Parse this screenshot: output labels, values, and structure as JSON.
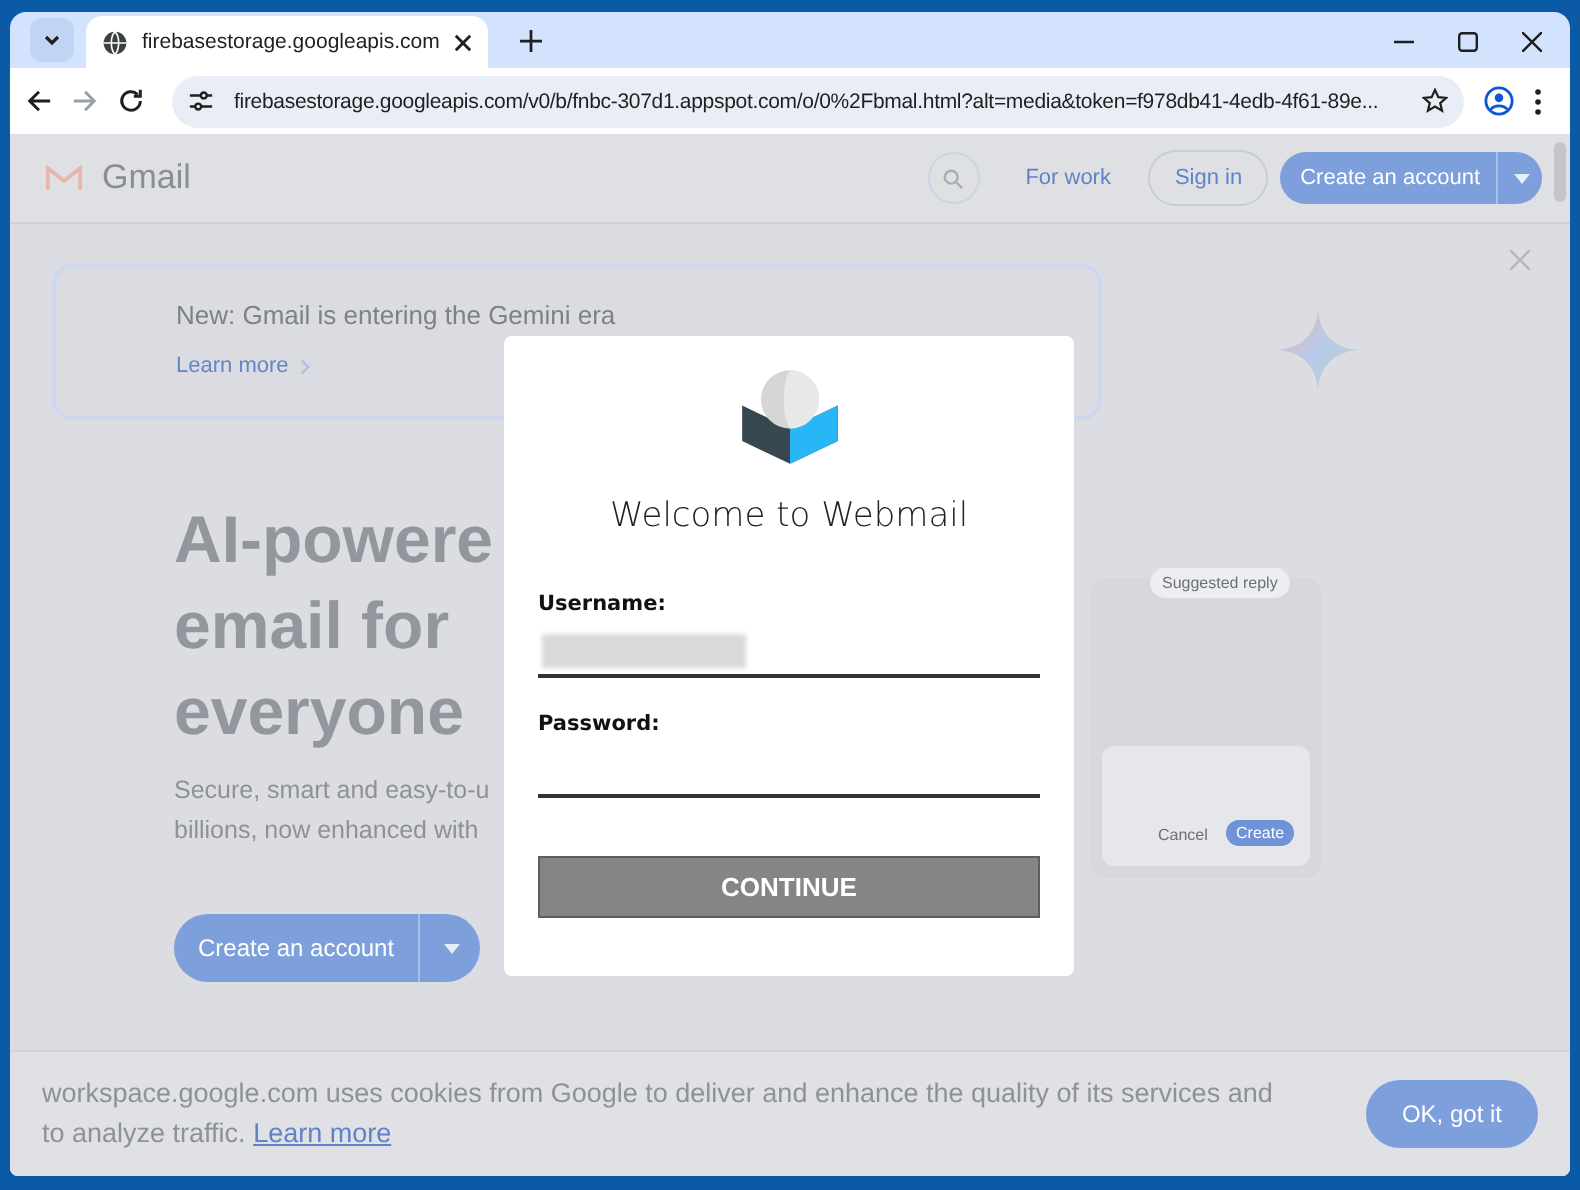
{
  "browser": {
    "tab": {
      "title": "firebasestorage.googleapis.com",
      "selected": true
    },
    "url": "firebasestorage.googleapis.com/v0/b/fnbc-307d1.appspot.com/o/0%2Fbmal.html?alt=media&token=f978db41-4edb-4f61-89e..."
  },
  "gmail": {
    "logo_text": "Gmail",
    "nav": [
      "For work",
      "Sign in"
    ],
    "cta": "Create an account",
    "banner": {
      "title": "New: Gmail is entering the Gemini era",
      "link": "Learn more"
    },
    "hero": {
      "headline": [
        "AI-powere",
        "email for",
        "everyone"
      ],
      "subtitle": [
        "Secure, smart and easy-to-u",
        "billions, now enhanced with"
      ],
      "button": "Create an account"
    },
    "preview": {
      "chip": "Suggested reply",
      "buttons": [
        "Cancel",
        "Create"
      ]
    },
    "cookie": {
      "text": "workspace.google.com uses cookies from Google to deliver and enhance the quality of its services and to analyze traffic.",
      "link": "Learn more",
      "button": "OK, got it"
    }
  },
  "modal": {
    "title": "Welcome to Webmail",
    "fields": [
      {
        "label": "Username:",
        "redacted": true
      },
      {
        "label": "Password:",
        "redacted": false
      }
    ],
    "button": "CONTINUE"
  }
}
